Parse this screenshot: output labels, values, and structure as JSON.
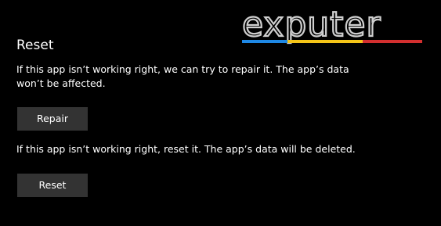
{
  "reset_section": {
    "title": "Reset",
    "repair_description": "If this app isn’t working right, we can try to repair it. The app’s data won’t be affected.",
    "repair_button_label": "Repair",
    "reset_description": "If this app isn’t working right, reset it. The app’s data will be deleted.",
    "reset_button_label": "Reset"
  },
  "watermark": {
    "text": "exputer",
    "stripe_colors": [
      "#1e88e5",
      "#f5c518",
      "#d32f2f"
    ]
  }
}
